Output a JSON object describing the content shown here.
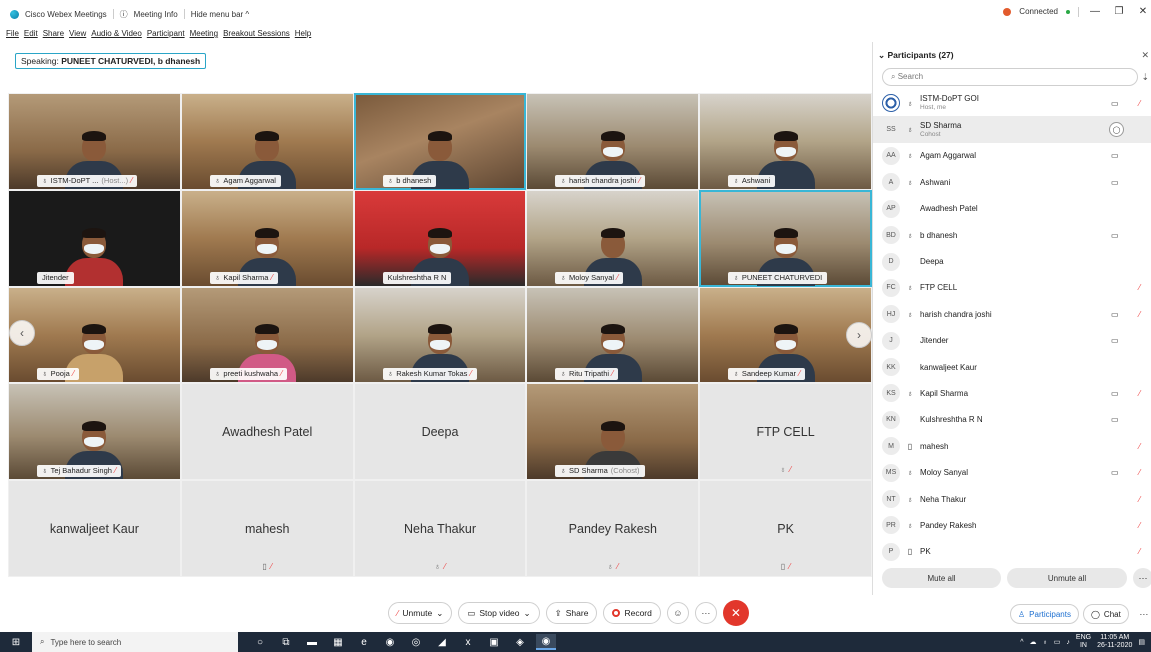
{
  "titlebar": {
    "app_name": "Cisco Webex Meetings",
    "meeting_info": "Meeting Info",
    "hide_menu_bar": "Hide menu bar ^",
    "connection_status": "Connected",
    "colors": {
      "connected_icon": "#e25b2d",
      "connected_dot": "#2aa845"
    }
  },
  "menubar": [
    "File",
    "Edit",
    "Share",
    "View",
    "Audio & Video",
    "Participant",
    "Meeting",
    "Breakout Sessions",
    "Help"
  ],
  "speaking": {
    "label": "Speaking:",
    "names": "PUNEET CHATURVEDI, b dhanesh"
  },
  "grid": {
    "video_tiles": [
      {
        "name": "ISTM-DoPT ...",
        "sub": "(Host...)",
        "muted": true
      },
      {
        "name": "Agam Aggarwal",
        "sub": "",
        "muted": false
      },
      {
        "name": "b dhanesh",
        "sub": "",
        "muted": false
      },
      {
        "name": "harish chandra joshi",
        "sub": "",
        "muted": true
      },
      {
        "name": "Ashwani",
        "sub": "",
        "muted": false
      },
      {
        "name": "Jitender",
        "sub": "",
        "muted": false
      },
      {
        "name": "Kapil Sharma",
        "sub": "",
        "muted": true
      },
      {
        "name": "Kulshreshtha R N",
        "sub": "",
        "muted": false
      },
      {
        "name": "Moloy Sanyal",
        "sub": "",
        "muted": true
      },
      {
        "name": "PUNEET CHATURVEDI",
        "sub": "",
        "muted": false
      },
      {
        "name": "Pooja",
        "sub": "",
        "muted": true
      },
      {
        "name": "preeti kushwaha",
        "sub": "",
        "muted": true
      },
      {
        "name": "Rakesh Kumar Tokas",
        "sub": "",
        "muted": true
      },
      {
        "name": "Ritu Tripathi",
        "sub": "",
        "muted": true
      },
      {
        "name": "Sandeep Kumar",
        "sub": "",
        "muted": true
      },
      {
        "name": "Tej Bahadur Singh",
        "sub": "",
        "muted": true
      },
      {
        "name": "SD Sharma",
        "sub": "(Cohost)",
        "muted": false
      }
    ],
    "blank_tiles": [
      "Awadhesh Patel",
      "Deepa",
      "FTP CELL",
      "kanwaljeet Kaur",
      "mahesh",
      "Neha Thakur",
      "Pandey Rakesh",
      "PK"
    ]
  },
  "panel": {
    "title": "Participants (27)",
    "search_placeholder": "Search",
    "participants": [
      {
        "initials": "",
        "name": "ISTM-DoPT GOI",
        "role": "Host, me",
        "cam": true,
        "muted": true
      },
      {
        "initials": "SS",
        "name": "SD Sharma",
        "role": "Cohost",
        "cam": false,
        "muted": false
      },
      {
        "initials": "AA",
        "name": "Agam Aggarwal",
        "role": "",
        "cam": true,
        "muted": false
      },
      {
        "initials": "A",
        "name": "Ashwani",
        "role": "",
        "cam": true,
        "muted": false
      },
      {
        "initials": "AP",
        "name": "Awadhesh Patel",
        "role": "",
        "cam": false,
        "muted": false
      },
      {
        "initials": "BD",
        "name": "b dhanesh",
        "role": "",
        "cam": true,
        "muted": false
      },
      {
        "initials": "D",
        "name": "Deepa",
        "role": "",
        "cam": false,
        "muted": false
      },
      {
        "initials": "FC",
        "name": "FTP CELL",
        "role": "",
        "cam": false,
        "muted": true
      },
      {
        "initials": "HJ",
        "name": "harish chandra joshi",
        "role": "",
        "cam": true,
        "muted": true
      },
      {
        "initials": "J",
        "name": "Jitender",
        "role": "",
        "cam": true,
        "muted": false
      },
      {
        "initials": "KK",
        "name": "kanwaljeet Kaur",
        "role": "",
        "cam": false,
        "muted": false
      },
      {
        "initials": "KS",
        "name": "Kapil Sharma",
        "role": "",
        "cam": true,
        "muted": true
      },
      {
        "initials": "KN",
        "name": "Kulshreshtha R N",
        "role": "",
        "cam": true,
        "muted": false
      },
      {
        "initials": "M",
        "name": "mahesh",
        "role": "",
        "cam": false,
        "muted": true
      },
      {
        "initials": "MS",
        "name": "Moloy Sanyal",
        "role": "",
        "cam": true,
        "muted": true
      },
      {
        "initials": "NT",
        "name": "Neha Thakur",
        "role": "",
        "cam": false,
        "muted": true
      },
      {
        "initials": "PR",
        "name": "Pandey Rakesh",
        "role": "",
        "cam": false,
        "muted": true
      },
      {
        "initials": "P",
        "name": "PK",
        "role": "",
        "cam": false,
        "muted": true
      }
    ],
    "mute_all": "Mute all",
    "unmute_all": "Unmute all"
  },
  "controls": {
    "unmute": "Unmute",
    "stop_video": "Stop video",
    "share": "Share",
    "record": "Record"
  },
  "bottom_right": {
    "participants": "Participants",
    "chat": "Chat"
  },
  "taskbar": {
    "search_placeholder": "Type here to search",
    "lang_top": "ENG",
    "lang_bottom": "IN",
    "time": "11:05 AM",
    "date": "26-11-2020"
  }
}
